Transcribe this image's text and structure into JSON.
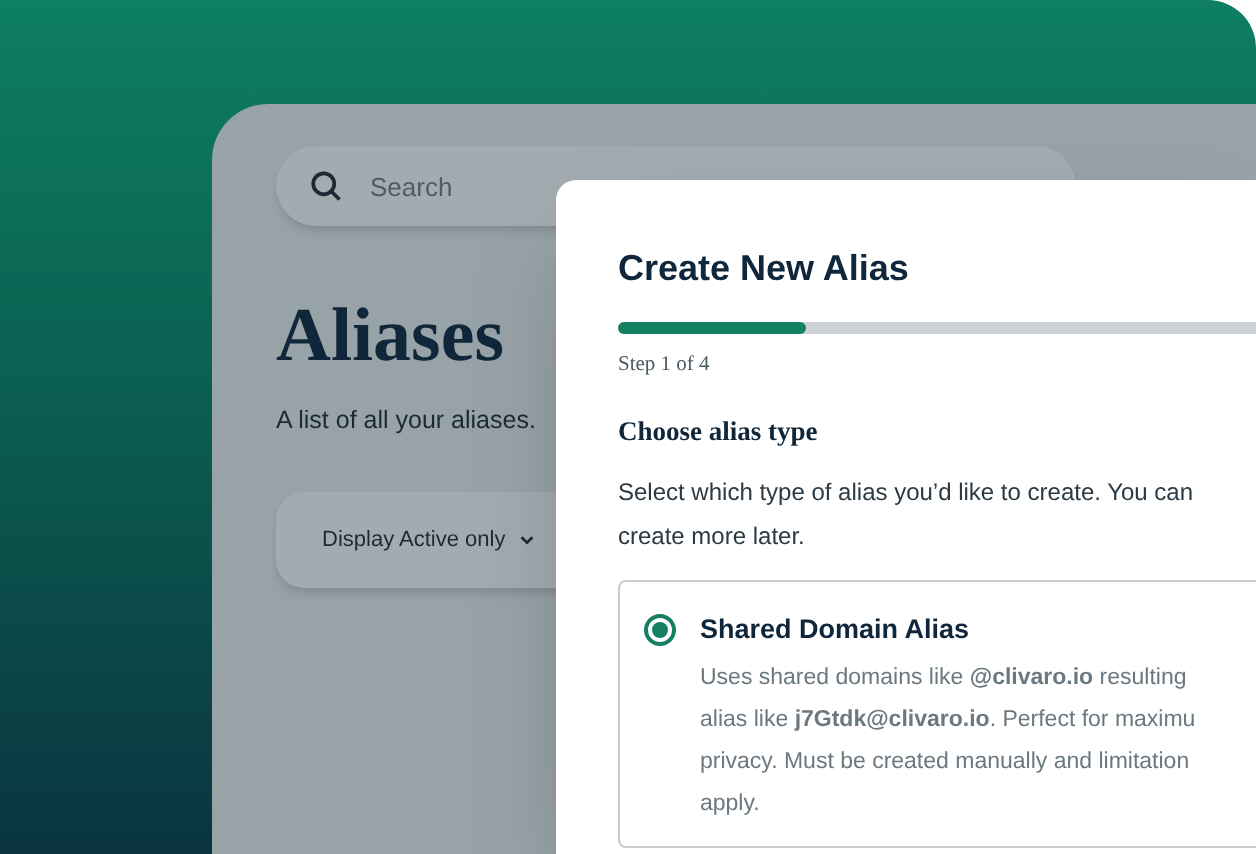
{
  "background_page": {
    "search": {
      "placeholder": "Search"
    },
    "title": "Aliases",
    "subtitle": "A list of all your aliases.",
    "filter": {
      "label": "Display Active only"
    }
  },
  "modal": {
    "title": "Create New Alias",
    "progress": {
      "level": 0.25,
      "label": "Step 1 of 4"
    },
    "section_title": "Choose alias type",
    "instructions": "Select which type of alias you’d like to create. You can\ncreate more later.",
    "options": [
      {
        "title": "Shared Domain Alias",
        "selected": true,
        "description": "Uses shared domains like **@clivaro.io** resulting\nalias like **j7Gtdk@clivaro.io**. Perfect for maximu\nprivacy. Must be created manually and limitation\napply."
      }
    ]
  }
}
